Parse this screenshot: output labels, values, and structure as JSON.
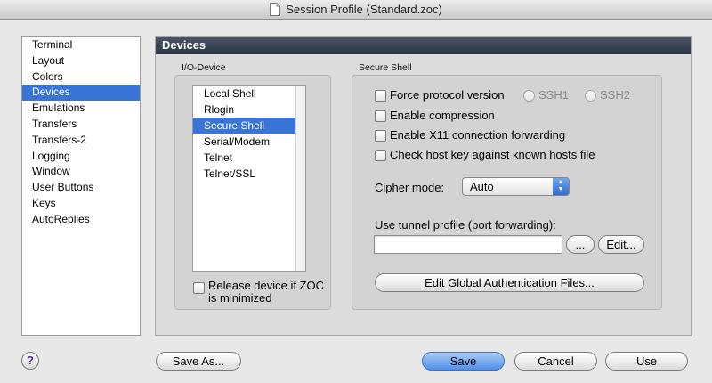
{
  "window": {
    "title": "Session Profile (Standard.zoc)"
  },
  "sidebar": {
    "items": [
      {
        "label": "Terminal"
      },
      {
        "label": "Layout"
      },
      {
        "label": "Colors"
      },
      {
        "label": "Devices",
        "selected": true
      },
      {
        "label": "Emulations"
      },
      {
        "label": "Transfers"
      },
      {
        "label": "Transfers-2"
      },
      {
        "label": "Logging"
      },
      {
        "label": "Window"
      },
      {
        "label": "User Buttons"
      },
      {
        "label": "Keys"
      },
      {
        "label": "AutoReplies"
      }
    ]
  },
  "panel": {
    "header": "Devices",
    "io_device": {
      "label": "I/O-Device",
      "items": [
        {
          "label": "Local Shell"
        },
        {
          "label": "Rlogin"
        },
        {
          "label": "Secure Shell",
          "selected": true
        },
        {
          "label": "Serial/Modem"
        },
        {
          "label": "Telnet"
        },
        {
          "label": "Telnet/SSL"
        }
      ],
      "release_label": "Release device if ZOC",
      "release_label_2": "is minimized",
      "release_checked": false
    },
    "ssh": {
      "label": "Secure Shell",
      "force_protocol_label": "Force protocol version",
      "force_protocol_checked": false,
      "ssh1_label": "SSH1",
      "ssh2_label": "SSH2",
      "compression_label": "Enable compression",
      "compression_checked": false,
      "x11_label": "Enable X11 connection forwarding",
      "x11_checked": false,
      "hostkey_label": "Check host key against known hosts file",
      "hostkey_checked": false,
      "cipher_label": "Cipher mode:",
      "cipher_value": "Auto",
      "tunnel_label": "Use tunnel profile (port forwarding):",
      "tunnel_value": "",
      "browse_label": "...",
      "edit_label": "Edit...",
      "global_auth_label": "Edit Global Authentication Files..."
    }
  },
  "footer": {
    "help_label": "?",
    "save_as_label": "Save As...",
    "save_label": "Save",
    "cancel_label": "Cancel",
    "use_label": "Use"
  }
}
